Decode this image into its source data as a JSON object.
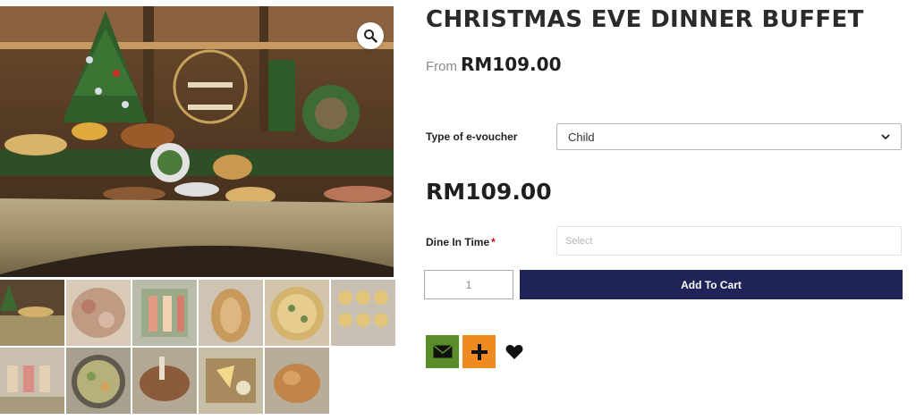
{
  "product": {
    "title": "CHRISTMAS EVE DINNER BUFFET",
    "from_label": "From",
    "from_price": "RM109.00",
    "price": "RM109.00"
  },
  "gallery": {
    "main_image": "christmas-buffet-table-photo",
    "zoom_icon": "magnifier-icon",
    "thumbnails": [
      "buffet-table-thumb",
      "cold-cuts-platter-thumb",
      "sashimi-platter-thumb",
      "braided-bread-thumb",
      "quiche-thumb",
      "mini-tarts-thumb",
      "dessert-glasses-thumb",
      "soup-bowl-thumb",
      "roast-lamb-thumb",
      "cheese-board-thumb",
      "roast-chicken-thumb"
    ]
  },
  "form": {
    "voucher_label": "Type of e-voucher",
    "voucher_value": "Child",
    "dine_time_label": "Dine In Time",
    "dine_time_required": "*",
    "dine_time_placeholder": "Select",
    "quantity": "1",
    "add_to_cart": "Add To Cart"
  },
  "share": {
    "email_icon": "envelope-icon",
    "more_icon": "plus-icon",
    "wishlist_icon": "heart-icon"
  },
  "colors": {
    "cart_button": "#1f2357",
    "share_email": "#5b8c2a",
    "share_plus": "#ee8a1f",
    "required_star": "#d0021b"
  }
}
